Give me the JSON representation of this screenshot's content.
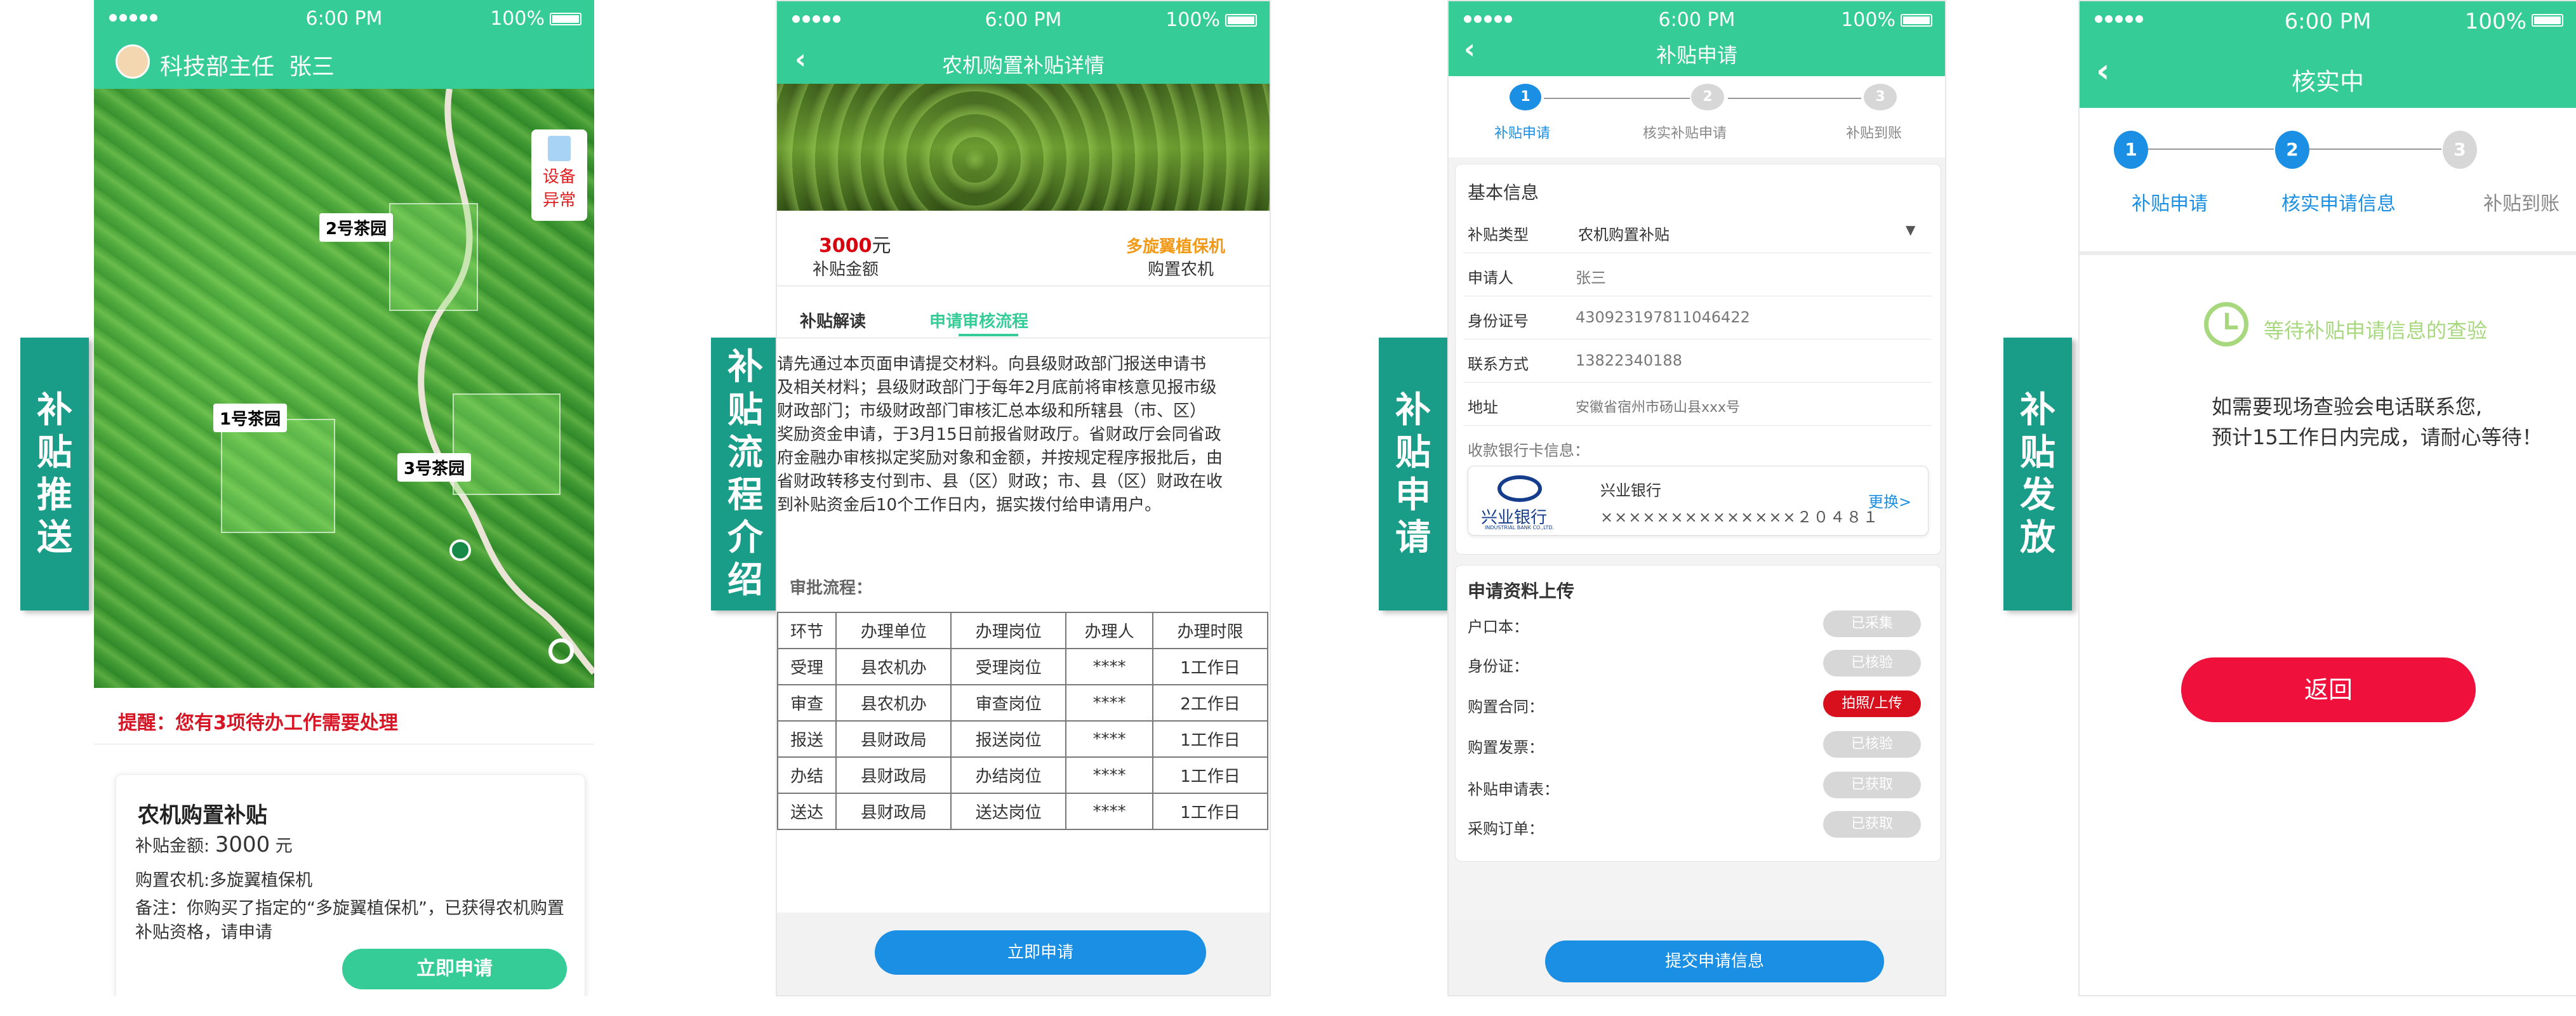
{
  "tabs": {
    "push": [
      "补",
      "贴",
      "推",
      "送"
    ],
    "process": [
      "补",
      "贴",
      "流",
      "程",
      "介",
      "绍"
    ],
    "apply": [
      "补",
      "贴",
      "申",
      "请"
    ],
    "issue": [
      "补",
      "贴",
      "发",
      "放"
    ]
  },
  "status": {
    "time": "6:00 PM",
    "battery": "100%"
  },
  "screen1": {
    "user": "科技部主任  张三",
    "gardens": [
      "2号茶园",
      "1号茶园",
      "3号茶园"
    ],
    "alert_badge": [
      "设备",
      "异常"
    ],
    "reminder": "提醒：您有3项待办工作需要处理",
    "card": {
      "title": "农机购置补贴",
      "amount_label": "补贴金额: ",
      "amount_value": "3000",
      "amount_unit": " 元",
      "machine": "购置农机:多旋翼植保机",
      "note": "备注：你购买了指定的“多旋翼植保机”，已获得农机购置补贴资格，请申请",
      "button": "立即申请"
    }
  },
  "screen2": {
    "title": "农机购置补贴详情",
    "amount_num": "3000",
    "amount_unit": "元",
    "amount_caption": "补贴金额",
    "machine_name": "多旋翼植保机",
    "machine_caption": "购置农机",
    "tab_read": "补贴解读",
    "tab_flow": "申请审核流程",
    "paragraph": [
      "请先通过本页面申请提交材料。向县级财政部门报送申请书",
      "及相关材料；县级财政部门于每年2月底前将审核意见报市级",
      "财政部门；市级财政部门审核汇总本级和所辖县（市、区）",
      "奖励资金申请，于3月15日前报省财政厅。省财政厅会同省政",
      "府金融办审核拟定奖励对象和金额，并按规定程序报批后，由",
      "省财政转移支付到市、县（区）财政；市、县（区）财政在收",
      "到补贴资金后10个工作日内，据实拨付给申请用户。"
    ],
    "overlap_text": "审批流程：",
    "table": {
      "headers": [
        "环节",
        "办理单位",
        "办理岗位",
        "办理人",
        "办理时限"
      ],
      "rows": [
        [
          "受理",
          "县农机办",
          "受理岗位",
          "****",
          "1工作日"
        ],
        [
          "审查",
          "县农机办",
          "审查岗位",
          "****",
          "2工作日"
        ],
        [
          "报送",
          "县财政局",
          "报送岗位",
          "****",
          "1工作日"
        ],
        [
          "办结",
          "县财政局",
          "办结岗位",
          "****",
          "1工作日"
        ],
        [
          "送达",
          "县财政局",
          "送达岗位",
          "****",
          "1工作日"
        ]
      ]
    },
    "button": "立即申请"
  },
  "screen3": {
    "title": "补贴申请",
    "steps": [
      "补贴申请",
      "核实补贴申请",
      "补贴到账"
    ],
    "basic_title": "基本信息",
    "fields": [
      {
        "label": "补贴类型",
        "value": "农机购置补贴"
      },
      {
        "label": "申请人",
        "value": "张三"
      },
      {
        "label": "身份证号",
        "value": "430923197811046422"
      },
      {
        "label": "联系方式",
        "value": "13822340188"
      },
      {
        "label": "地址",
        "value": "安徽省宿州市砀山县xxx号"
      }
    ],
    "bank_label": "收款银行卡信息：",
    "bank_name": "兴业银行",
    "bank_logo_text": "兴业银行",
    "bank_logo_sub": "INDUSTRIAL BANK CO.,LTD.",
    "card_number": "××××××××××××××２０４８１",
    "change": "更换>",
    "upload_title": "申请资料上传",
    "uploads": [
      {
        "label": "户口本：",
        "status": "已采集"
      },
      {
        "label": "身份证：",
        "status": "已核验"
      },
      {
        "label": "购置合同：",
        "status": "拍照/上传"
      },
      {
        "label": "购置发票：",
        "status": "已核验"
      },
      {
        "label": "补贴申请表：",
        "status": "已获取"
      },
      {
        "label": "采购订单：",
        "status": "已获取"
      }
    ],
    "button": "提交申请信息"
  },
  "screen4": {
    "title": "核实中",
    "steps": [
      "补贴申请",
      "核实申请信息",
      "补贴到账"
    ],
    "wait": "等待补贴申请信息的查验",
    "msg1": "如需要现场查验会电话联系您,",
    "msg2": "预计15工作日内完成，请耐心等待！",
    "button": "返回"
  },
  "colors": {
    "green": "#35cc98",
    "teal": "#199c88",
    "blue": "#1a8fe3",
    "red": "#f0103c"
  }
}
